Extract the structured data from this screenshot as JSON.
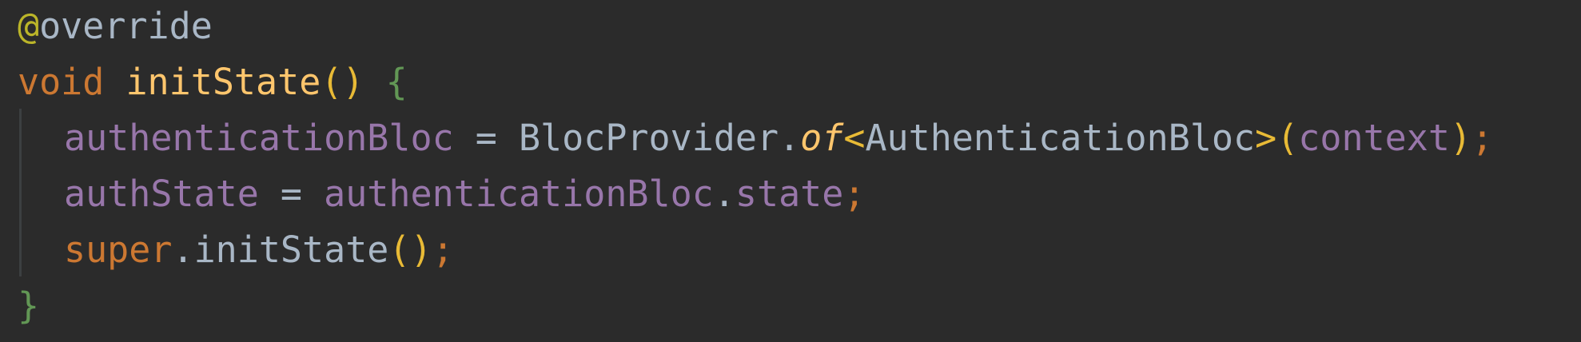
{
  "code": {
    "line1": {
      "at": "@",
      "annotation": "override"
    },
    "line2": {
      "kw": "void",
      "sp": " ",
      "fn": "initState",
      "parens": "()",
      "sp2": " ",
      "brace": "{"
    },
    "line3": {
      "field": "authenticationBloc",
      "eq": " = ",
      "cls": "BlocProvider.",
      "method": "of",
      "lt": "<",
      "type": "AuthenticationBloc",
      "gt": ">",
      "lp": "(",
      "arg": "context",
      "rp": ")",
      "semi": ";"
    },
    "line4": {
      "field": "authState",
      "eq": " = ",
      "obj": "authenticationBloc",
      "dot": ".",
      "prop": "state",
      "semi": ";"
    },
    "line5": {
      "kw": "super",
      "dot": ".",
      "fn": "initState",
      "parens": "()",
      "semi": ";"
    },
    "line6": {
      "brace": "}"
    }
  }
}
